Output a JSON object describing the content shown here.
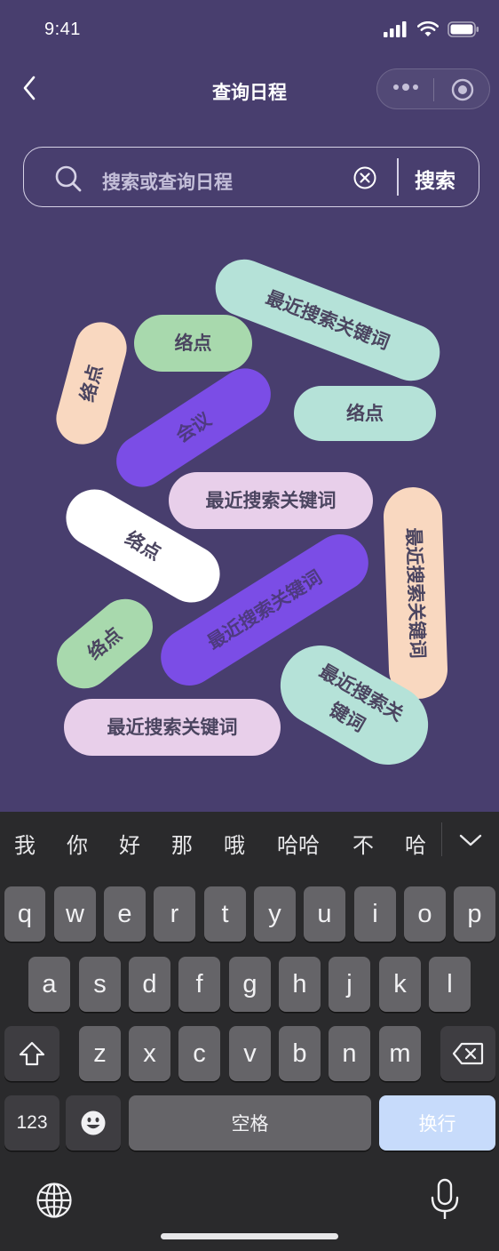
{
  "status_bar": {
    "time": "9:41"
  },
  "nav": {
    "title": "查询日程"
  },
  "search": {
    "placeholder": "搜索或查询日程",
    "button_label": "搜索"
  },
  "tags": [
    {
      "text": "最近搜索关键词",
      "color": "#b5e2d8"
    },
    {
      "text": "络点",
      "color": "#f9d8c0"
    },
    {
      "text": "络点",
      "color": "#a8d9ad"
    },
    {
      "text": "会议",
      "color": "#7b4de6"
    },
    {
      "text": "络点",
      "color": "#b5e2d8"
    },
    {
      "text": "最近搜索关键词",
      "color": "#e8cfea"
    },
    {
      "text": "最近搜索关键词",
      "color": "#f9d8c0"
    },
    {
      "text": "络点",
      "color": "#ffffff"
    },
    {
      "text": "最近搜索关键词",
      "color": "#7b4de6"
    },
    {
      "text": "络点",
      "color": "#a8d9ad"
    },
    {
      "text": "最近搜索关键词",
      "color": "#b5e2d8"
    },
    {
      "text": "最近搜索关键词",
      "color": "#e8cfea"
    }
  ],
  "keyboard": {
    "candidates": [
      "我",
      "你",
      "好",
      "那",
      "哦",
      "哈哈",
      "不",
      "哈"
    ],
    "row1": [
      "q",
      "w",
      "e",
      "r",
      "t",
      "y",
      "u",
      "i",
      "o",
      "p"
    ],
    "row2": [
      "a",
      "s",
      "d",
      "f",
      "g",
      "h",
      "j",
      "k",
      "l"
    ],
    "row3": [
      "z",
      "x",
      "c",
      "v",
      "b",
      "n",
      "m"
    ],
    "numbers_key": "123",
    "space_key": "空格",
    "return_key": "换行"
  }
}
